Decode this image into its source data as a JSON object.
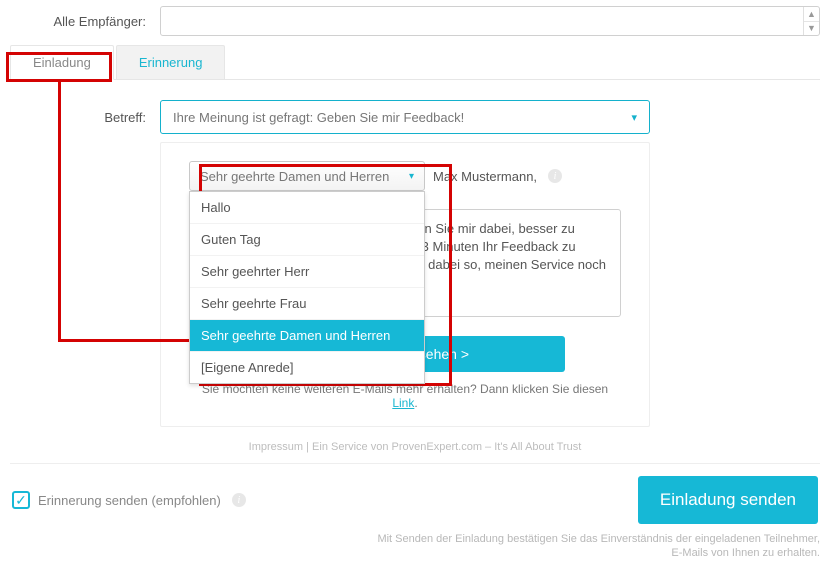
{
  "recipients": {
    "label": "Alle Empfänger:",
    "value": ""
  },
  "tabs": {
    "invitation": "Einladung",
    "reminder": "Erinnerung"
  },
  "subject": {
    "label": "Betreff:",
    "selected": "Ihre Meinung ist gefragt: Geben Sie mir Feedback!"
  },
  "salutation": {
    "selected": "Sehr geehrte Damen und Herren",
    "recipient_name": "Max Mustermann,",
    "options": [
      "Hallo",
      "Guten Tag",
      "Sehr geehrter Herr",
      "Sehr geehrte Frau",
      "Sehr geehrte Damen und Herren",
      "[Eigene Anrede]"
    ],
    "highlight_index": 4
  },
  "body_text": "Ihre Meinung ist mir wichtig! Bitte helfen Sie mir dabei, besser zu werden. Geben Sie mir in weniger als 3 Minuten Ihr Feedback zu meinen Leistungen. Ihr Beitrag hilft mir dabei so, meinen Service noch besser auf Sie abzustimmen.",
  "preview_button": "Vorschau ansehen >",
  "opt_out": {
    "text_prefix": "Sie möchten keine weiteren E-Mails mehr erhalten? Dann klicken Sie diesen ",
    "link_text": "Link",
    "text_suffix": "."
  },
  "imprint": "Impressum | Ein Service von ProvenExpert.com – It's All About Trust",
  "reminder_checkbox": {
    "checked": true,
    "label": "Erinnerung senden (empfohlen)"
  },
  "send_button": "Einladung senden",
  "consent": {
    "line1": "Mit Senden der Einladung bestätigen Sie das Einverständnis der eingeladenen Teilnehmer,",
    "line2": "E-Mails von Ihnen zu erhalten."
  },
  "colors": {
    "accent": "#16b8d6",
    "annotation": "#d40303"
  }
}
